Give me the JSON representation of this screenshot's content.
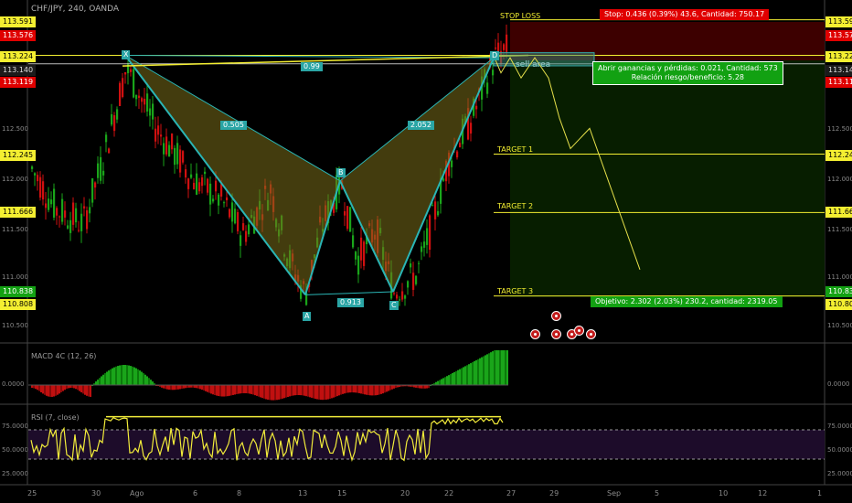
{
  "symbol": "CHF/JPY, 240, OANDA",
  "axis": {
    "price_ticks": [
      "112.500",
      "112.000",
      "111.500",
      "111.000",
      "110.500"
    ],
    "time_ticks": [
      "25",
      "30",
      "Ago",
      "6",
      "8",
      "13",
      "15",
      "20",
      "22",
      "27",
      "29",
      "Sep",
      "5",
      "10",
      "12",
      "1"
    ],
    "macd_tick": "0.0000",
    "rsi_ticks": [
      "75.0000",
      "50.0000",
      "25.0000"
    ]
  },
  "price_labels": [
    {
      "value": "113.591",
      "style": "yel"
    },
    {
      "value": "113.576",
      "style": "red"
    },
    {
      "value": "113.224",
      "style": "yel"
    },
    {
      "value": "113.140",
      "style": "dk"
    },
    {
      "value": "113.119",
      "style": "red"
    },
    {
      "value": "112.245",
      "style": "yel"
    },
    {
      "value": "111.666",
      "style": "yel"
    },
    {
      "value": "110.838",
      "style": "grn"
    },
    {
      "value": "110.808",
      "style": "yel"
    }
  ],
  "annotations": {
    "stop_loss": "STOP LOSS",
    "stop_box": "Stop: 0.436 (0.39%) 43.6, Cantidad: 750.17",
    "pnl_line1": "Abrir ganancias y pérdidas: 0.021, Cantidad: 573",
    "pnl_line2": "Relación riesgo/beneficio: 5.28",
    "target1": "TARGET 1",
    "target2": "TARGET 2",
    "target3": "TARGET 3",
    "objective": "Objetivo: 2.302 (2.03%) 230.2, cantidad: 2319.05",
    "sell_area": "sell area",
    "point_x": "X",
    "point_a": "A",
    "point_b": "B",
    "point_c": "C",
    "point_d": "D",
    "ratio_xd": "0.99",
    "ratio_xb": "0.505",
    "ratio_ac": "0.913",
    "ratio_bd": "2.052"
  },
  "indicators": {
    "macd_label": "MACD 4C (12, 26)",
    "rsi_label": "RSI (7, close)"
  },
  "colors": {
    "bull": "#1aa51a",
    "bear": "#d01010",
    "pattern": "#2ab5b5",
    "highlight": "#f4ef31"
  },
  "chart_data": {
    "type": "candlestick",
    "x_range": [
      "Jul 25",
      "Sep 1"
    ],
    "ylim": [
      110.4,
      113.7
    ],
    "pattern": {
      "name": "harmonic bat",
      "points": [
        {
          "label": "X",
          "price": 113.224
        },
        {
          "label": "A",
          "price": 110.85
        },
        {
          "label": "B",
          "price": 111.98
        },
        {
          "label": "C",
          "price": 110.88
        },
        {
          "label": "D",
          "price": 113.2
        }
      ],
      "ratios": {
        "XB": 0.505,
        "AC": 0.913,
        "BD": 2.052,
        "XD": 0.99
      }
    },
    "levels": {
      "stop_loss": 113.576,
      "entry": 113.14,
      "target_1": 112.245,
      "target_2": 111.666,
      "target_3": 110.838
    },
    "rsi_levels": [
      70,
      30
    ]
  }
}
